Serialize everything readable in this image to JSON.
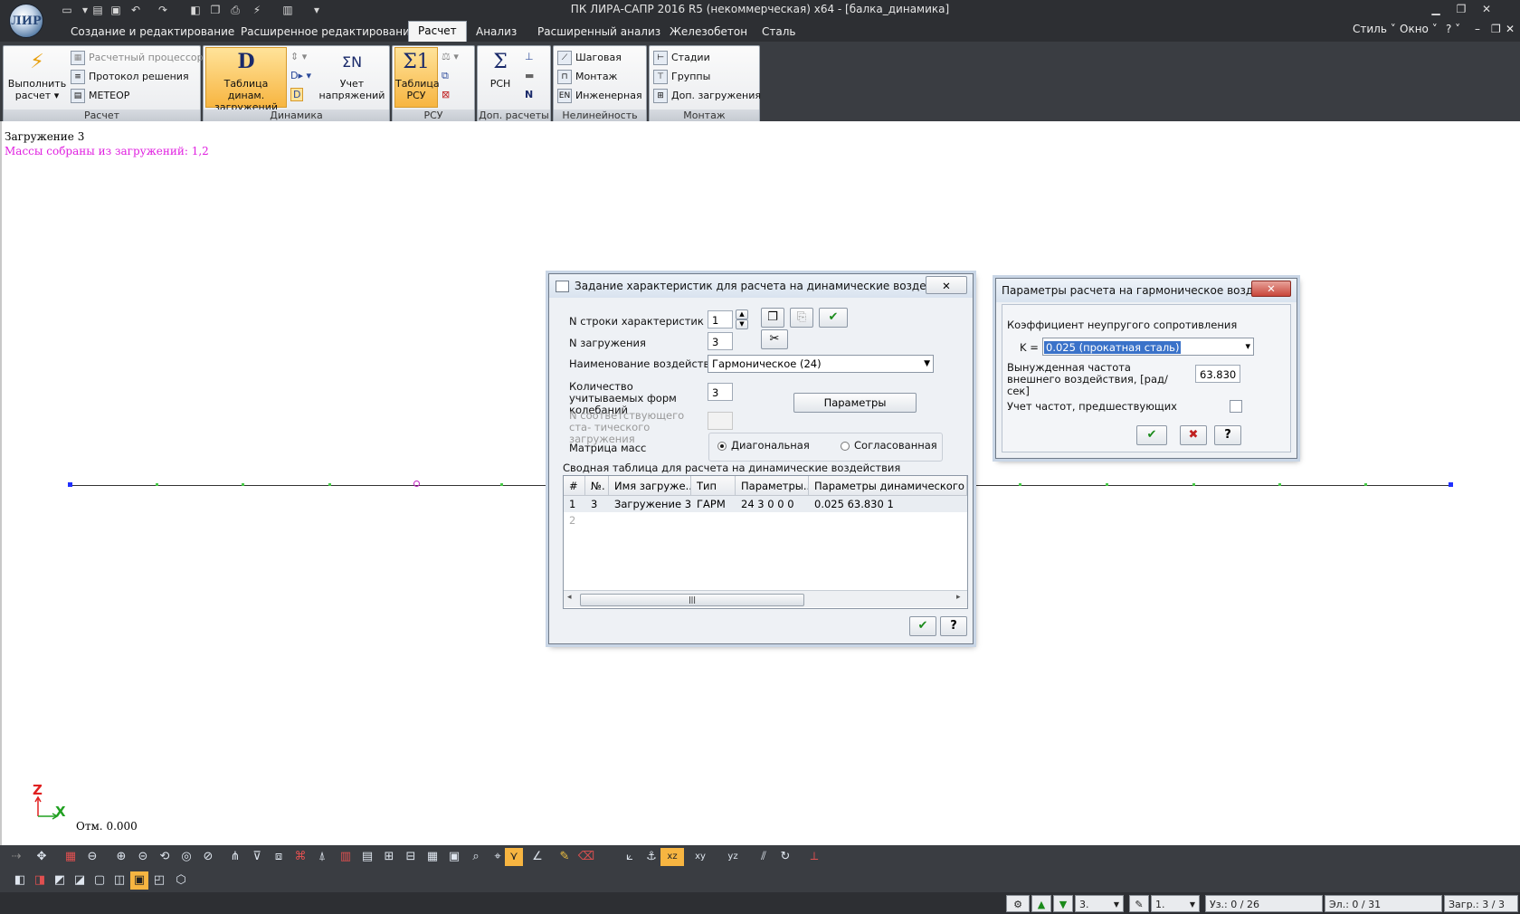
{
  "app": {
    "title": "ПК ЛИРА-САПР  2016 R5 (некоммерческая) x64 - [балка_динамика]",
    "logo_text": "ЛИР"
  },
  "menu": {
    "tabs": [
      "Создание и редактирование",
      "Расширенное редактирование",
      "Расчет",
      "Анализ",
      "Расширенный анализ",
      "Железобетон",
      "Сталь"
    ],
    "active": "Расчет",
    "right": [
      "Стиль",
      "Окно"
    ]
  },
  "ribbon": {
    "raschet": {
      "title": "Расчет",
      "run_label": "Выполнить расчет",
      "processor": "Расчетный процессор",
      "protocol": "Протокол решения",
      "meteor": "МЕТЕОР"
    },
    "dinamika": {
      "title": "Динамика",
      "table_label": "Таблица динам. загружений",
      "stress_label": "Учет напряжений"
    },
    "rsu": {
      "title": "РСУ",
      "table_label": "Таблица РСУ"
    },
    "dop": {
      "title": "Доп. расчеты",
      "rsn": "РСН"
    },
    "nelin": {
      "title": "Нелинейность",
      "items": [
        "Шаговая",
        "Монтаж",
        "Инженерная"
      ]
    },
    "montazh": {
      "title": "Монтаж",
      "items": [
        "Стадии",
        "Группы",
        "Доп. загружения"
      ]
    }
  },
  "canvas": {
    "load_title": "Загружение 3",
    "mass_info": "Массы собраны из загружений:  1,2",
    "axis_z": "Z",
    "axis_x": "X",
    "elevation": "Отм. 0.000"
  },
  "dialog_main": {
    "title": "Задание характеристик для расчета на динамические воздействия",
    "row_label": "N строки характеристик",
    "row_value": "1",
    "load_label": "N загружения",
    "load_value": "3",
    "action_label": "Наименование воздействия",
    "action_value": "Гармоническое  (24)",
    "modes_label": "Количество учитываемых форм колебаний",
    "modes_value": "3",
    "params_button": "Параметры",
    "static_label": "N соответствующего ста- тического загружения",
    "mass_label": "Матрица масс",
    "radio_diag": "Диагональная",
    "radio_cons": "Согласованная",
    "table_caption": "Сводная таблица для расчета на динамические воздействия",
    "columns": [
      "#",
      "№.",
      "Имя загруже...",
      "Тип",
      "Параметры...",
      "Параметры динамического возд"
    ],
    "rows": [
      [
        "1",
        "3",
        "Загружение 3",
        "ГАРМ",
        "24  3  0  0 0",
        "0.025 63.830 1"
      ],
      [
        "2",
        "",
        "",
        "",
        "",
        ""
      ]
    ]
  },
  "dialog_harm": {
    "title": "Параметры расчета на гармоническое воздейс...",
    "coef_label": "Коэффициент неупругого сопротивления",
    "k_label": "K =",
    "k_value": "0.025 (прокатная сталь)",
    "freq_label": "Вынужденная частота внешнего воздействия,  [рад/сек]",
    "freq_value": "63.830",
    "prev_label": "Учет частот, предшествующих"
  },
  "status": {
    "combo1": "3.",
    "combo2": "1.",
    "nodes": "Уз.: 0 / 26",
    "elements": "Эл.: 0 / 31",
    "loads": "Загр.: 3 / 3"
  },
  "colors": {
    "chrome": "#2d2f33",
    "ribbon_highlight": "#f7b541",
    "mass_text": "#e020e0",
    "node": "#2030ff",
    "axis_z": "#e02020",
    "axis_x": "#20a020"
  }
}
